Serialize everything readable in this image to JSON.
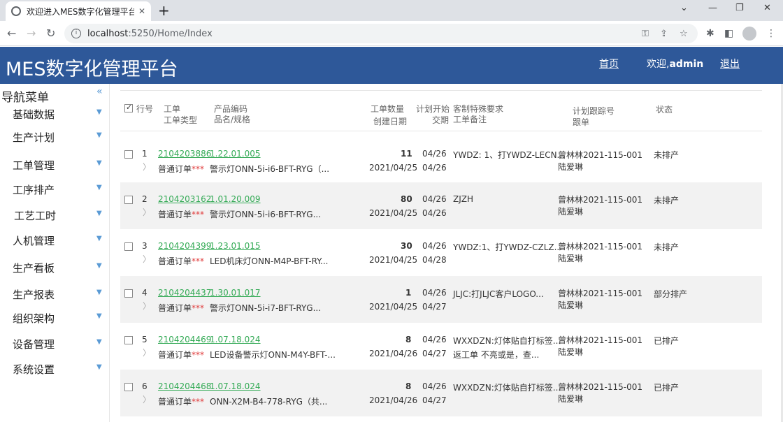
{
  "browser": {
    "tab_title": "欢迎进入MES数字化管理平台",
    "tab_close": "✕",
    "new_tab": "+",
    "url_host": "localhost",
    "url_rest": ":5250/Home/Index",
    "win_min": "⌄",
    "win_min2": "—",
    "win_restore": "❐",
    "win_close": "✕"
  },
  "app": {
    "title": "MES数字化管理平台",
    "nav_home": "首页",
    "welcome_prefix": "欢迎,",
    "welcome_user": "admin",
    "logout": "退出"
  },
  "sidebar": {
    "title": "导航菜单",
    "collapse": "«",
    "items": [
      {
        "label": "基础数据"
      },
      {
        "label": "生产计划"
      },
      {
        "label": "工单管理"
      },
      {
        "label": "工序排产"
      },
      {
        "label": "工艺工时"
      },
      {
        "label": "人机管理"
      },
      {
        "label": "生产看板"
      },
      {
        "label": "生产报表"
      },
      {
        "label": "组织架构"
      },
      {
        "label": "设备管理"
      },
      {
        "label": "系统设置"
      }
    ]
  },
  "table": {
    "headers": {
      "row_no": "行号",
      "order": "工单",
      "order_type": "工单类型",
      "product_code": "产品编码",
      "product_name": "品名/规格",
      "qty": "工单数量",
      "created": "创建日期",
      "plan_start": "计划开始",
      "delivery": "交期",
      "special": "客制特殊要求",
      "remark": "工单备注",
      "tracking": "计划跟踪号",
      "follower": "跟单",
      "status": "状态"
    },
    "rows": [
      {
        "no": "1",
        "order": "2104203886",
        "type": "普通订单",
        "star": "***",
        "code": "1.22.01.005",
        "name": "警示灯ONN-5i-i6-BFT-RYG（...",
        "qty": "11",
        "created": "2021/04/25",
        "start": "04/26",
        "delivery": "04/26",
        "special": "YWDZ: 1、打YWDZ-LECN...",
        "remark": "",
        "tracking": "曾林林2021-115-001",
        "follower": "陆爱琳",
        "status": "未排产"
      },
      {
        "no": "2",
        "order": "2104203162",
        "type": "普通订单",
        "star": "***",
        "code": "1.01.20.009",
        "name": "警示灯ONN-5i-i6-BFT-RYG...",
        "qty": "80",
        "created": "2021/04/25",
        "start": "04/26",
        "delivery": "04/26",
        "special": "ZJZH",
        "remark": "",
        "tracking": "曾林林2021-115-001",
        "follower": "陆爱琳",
        "status": "未排产"
      },
      {
        "no": "3",
        "order": "2104204399",
        "type": "普通订单",
        "star": "***",
        "code": "1.23.01.015",
        "name": "LED机床灯ONN-M4P-BFT-RY...",
        "qty": "30",
        "created": "2021/04/25",
        "start": "04/26",
        "delivery": "04/28",
        "special": "YWDZ:1、打YWDZ-CZLZ...",
        "remark": "",
        "tracking": "曾林林2021-115-001",
        "follower": "陆爱琳",
        "status": "未排产"
      },
      {
        "no": "4",
        "order": "2104204437",
        "type": "普通订单",
        "star": "***",
        "code": "1.30.01.017",
        "name": "警示灯ONN-5i-i7-BFT-RYG...",
        "qty": "1",
        "created": "2021/04/25",
        "start": "04/26",
        "delivery": "04/27",
        "special": "JLJC:打JLJC客户LOGO...",
        "remark": "",
        "tracking": "曾林林2021-115-001",
        "follower": "陆爱琳",
        "status": "部分排产"
      },
      {
        "no": "5",
        "order": "2104204469",
        "type": "普通订单",
        "star": "***",
        "code": "1.07.18.024",
        "name": "LED设备警示灯ONN-M4Y-BFT-...",
        "qty": "8",
        "created": "2021/04/26",
        "start": "04/26",
        "delivery": "04/27",
        "special": "WXXDZN:灯体贴自打标签...",
        "remark": "返工单 不亮或是，查...",
        "tracking": "曾林林2021-115-001",
        "follower": "陆爱琳",
        "status": "已排产"
      },
      {
        "no": "6",
        "order": "2104204468",
        "type": "普通订单",
        "star": "***",
        "code": "1.07.18.024",
        "name": "ONN-X2M-B4-778-RYG（共...",
        "qty": "8",
        "created": "2021/04/26",
        "start": "04/26",
        "delivery": "04/27",
        "special": "WXXDZN:灯体贴自打标签...",
        "remark": "",
        "tracking": "曾林林2021-115-001",
        "follower": "陆爱琳",
        "status": "已排产"
      }
    ]
  }
}
